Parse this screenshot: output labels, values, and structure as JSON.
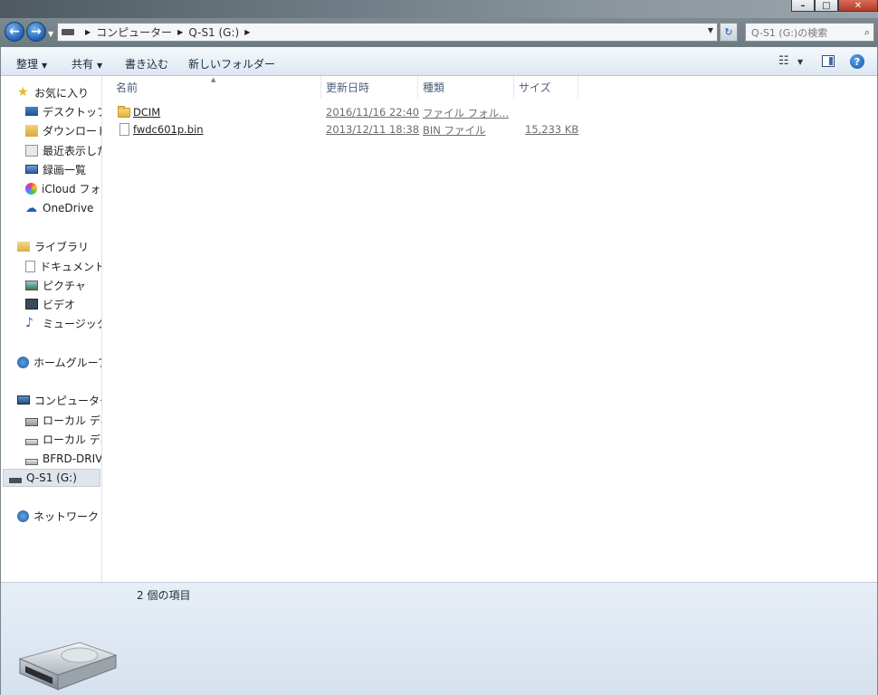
{
  "window": {
    "minimize_label": "–",
    "maximize_label": "□",
    "close_label": "✕"
  },
  "navigation": {
    "back_glyph": "←",
    "forward_glyph": "→",
    "address_segments": [
      "コンピューター",
      "Q-S1 (G:)"
    ],
    "refresh_glyph": "↻",
    "search_placeholder": "Q-S1 (G:)の検索"
  },
  "toolbar": {
    "organize_label": "整理",
    "share_label": "共有",
    "burn_label": "書き込む",
    "new_folder_label": "新しいフォルダー",
    "help_label": "?"
  },
  "sidebar": {
    "favorites": {
      "header": "お気に入り",
      "items": [
        "デスクトップ",
        "ダウンロード",
        "最近表示した",
        "録画一覧",
        "iCloud フォト",
        "OneDrive"
      ]
    },
    "libraries": {
      "header": "ライブラリ",
      "items": [
        "ドキュメント",
        "ピクチャ",
        "ビデオ",
        "ミュージック"
      ]
    },
    "homegroup": "ホームグループ",
    "computer": {
      "header": "コンピューター",
      "items": [
        "ローカル ディ",
        "ローカル ディ",
        "BFRD-DRIVE",
        "Q-S1 (G:)"
      ]
    },
    "network": "ネットワーク"
  },
  "file_list": {
    "columns": [
      "名前",
      "更新日時",
      "種類",
      "サイズ"
    ],
    "rows": [
      {
        "name": "DCIM",
        "date": "2016/11/16 22:40",
        "type": "ファイル フォル...",
        "size": "",
        "icon": "folder-icon"
      },
      {
        "name": "fwdc601p.bin",
        "date": "2013/12/11 18:38",
        "type": "BIN ファイル",
        "size": "15,233 KB",
        "icon": "file-icon"
      }
    ]
  },
  "details_pane": {
    "item_count": "2 個の項目",
    "icon": "removable-drive-icon"
  }
}
